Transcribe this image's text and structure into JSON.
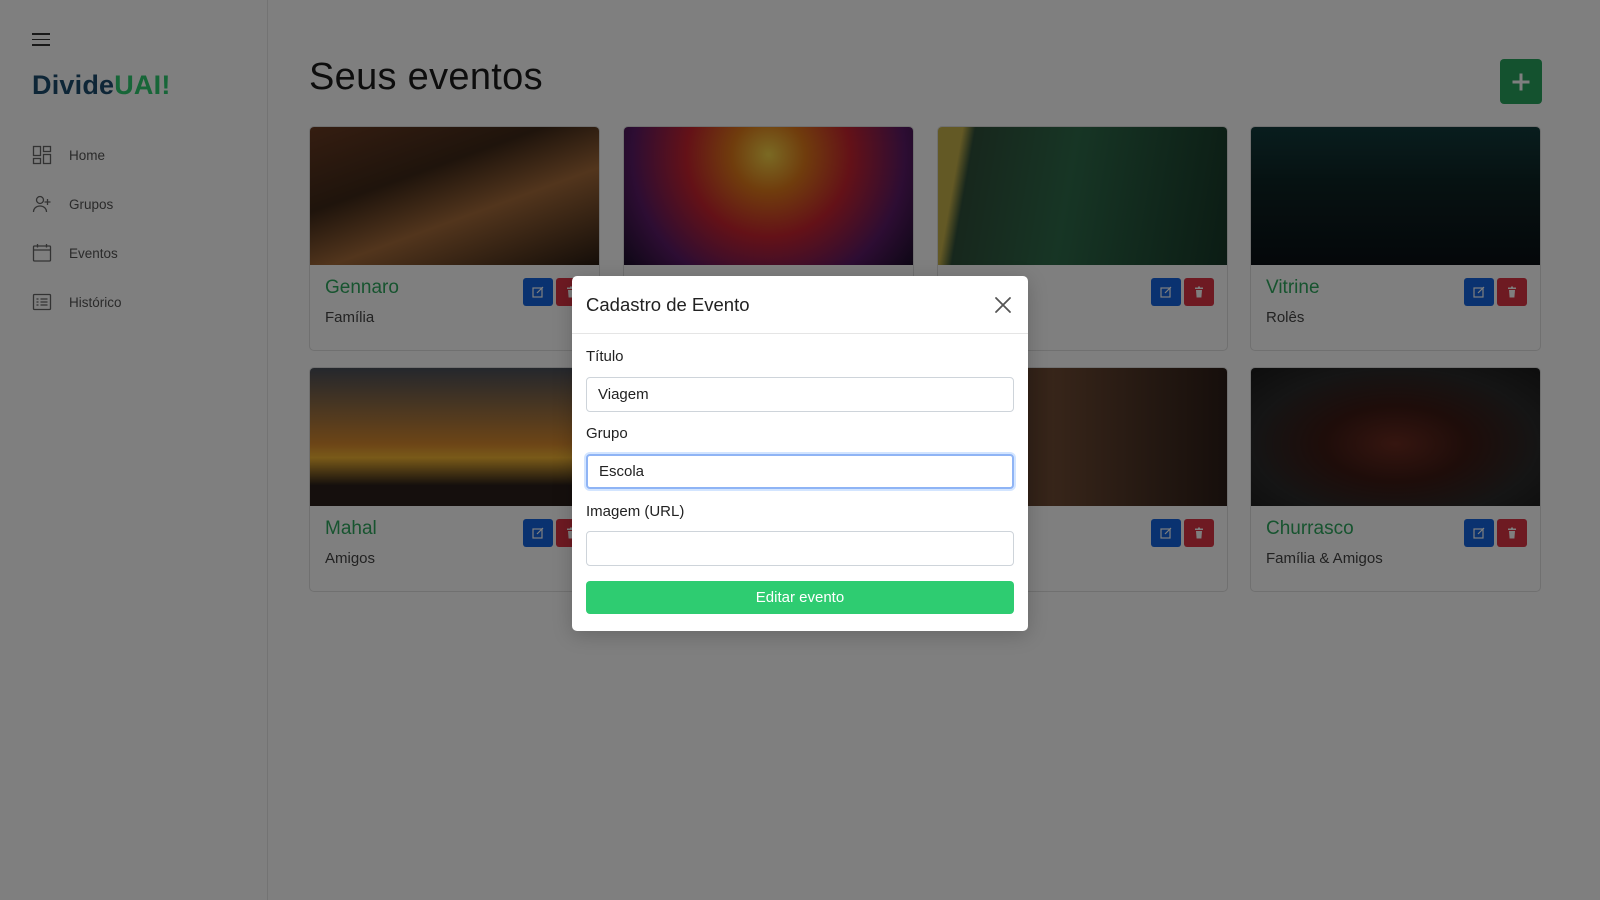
{
  "sidebar": {
    "logo_part1": "Divide",
    "logo_part2": "UAI!",
    "items": [
      {
        "label": "Home",
        "icon": "grid-icon"
      },
      {
        "label": "Grupos",
        "icon": "user-plus-icon"
      },
      {
        "label": "Eventos",
        "icon": "calendar-icon"
      },
      {
        "label": "Histórico",
        "icon": "list-icon"
      }
    ]
  },
  "main": {
    "title": "Seus eventos",
    "add_button_icon": "plus-icon",
    "cards": [
      {
        "title": "Gennaro",
        "subtitle": "Família"
      },
      {
        "title": "",
        "subtitle": ""
      },
      {
        "title": "",
        "subtitle": ""
      },
      {
        "title": "Vitrine",
        "subtitle": "Rolês"
      },
      {
        "title": "Mahal",
        "subtitle": "Amigos"
      },
      {
        "title": "",
        "subtitle": ""
      },
      {
        "title": "Churrasco",
        "subtitle": "Família & Amigos"
      }
    ]
  },
  "modal": {
    "title": "Cadastro de Evento",
    "titulo_label": "Título",
    "titulo_value": "Viagem",
    "grupo_label": "Grupo",
    "grupo_value": "Escola",
    "imagem_label": "Imagem (URL)",
    "imagem_value": "",
    "submit_label": "Editar evento"
  },
  "colors": {
    "accent_green": "#2ecc71",
    "edit_blue": "#1565e0",
    "delete_red": "#dc3545",
    "logo_blue": "#1d4d6e"
  }
}
